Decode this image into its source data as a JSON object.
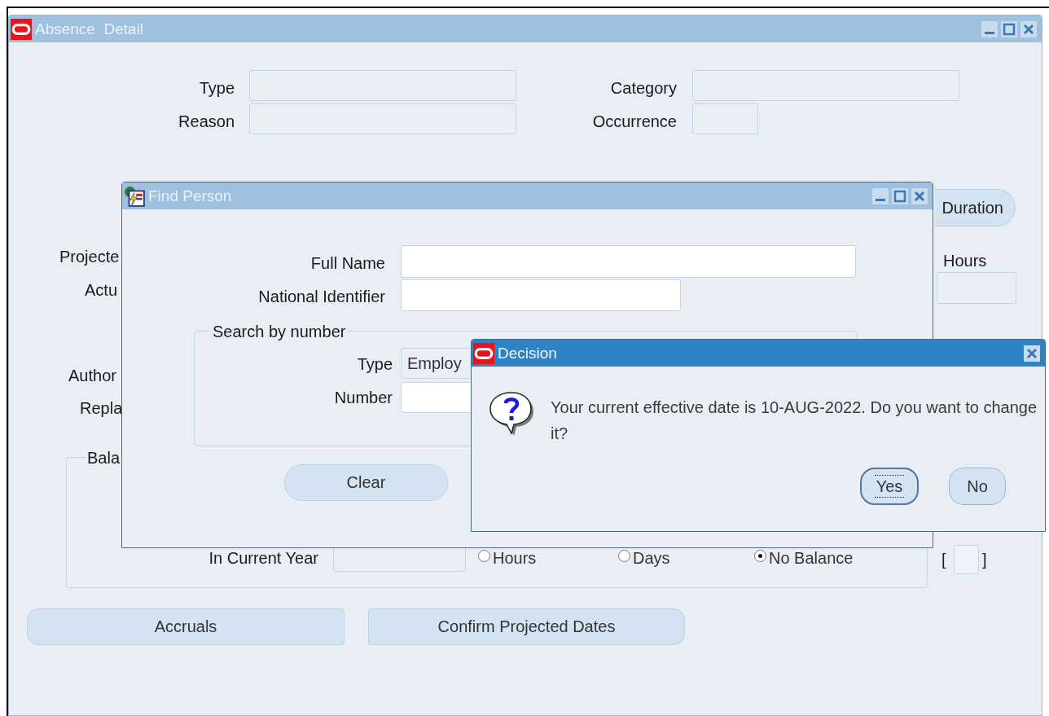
{
  "main_window": {
    "title": "Absence  Detail",
    "fields": [
      {
        "label": "Type"
      },
      {
        "label": "Category"
      },
      {
        "label": "Reason"
      },
      {
        "label": "Occurrence"
      }
    ],
    "duration_button": "Duration",
    "hours_label": "Hours",
    "partial_labels": [
      "Projecte",
      "Actu",
      "Author",
      "Repla"
    ],
    "balance": {
      "legend": "Bala",
      "in_current_year": "In Current Year",
      "units": [
        {
          "label": "Hours",
          "selected": false
        },
        {
          "label": "Days",
          "selected": false
        },
        {
          "label": "No Balance",
          "selected": true
        }
      ],
      "bracket_open": "[",
      "bracket_close": "]"
    },
    "buttons": [
      "Accruals",
      "Confirm Projected Dates"
    ]
  },
  "find_person": {
    "title": "Find Person",
    "fields": [
      {
        "label": "Full Name"
      },
      {
        "label": "National Identifier"
      }
    ],
    "search_group": {
      "legend": "Search by number",
      "type_label": "Type",
      "type_value": "Employ",
      "number_label": "Number"
    },
    "buttons": [
      "Clear"
    ]
  },
  "decision": {
    "title": "Decision",
    "message": "Your current effective date is 10-AUG-2022. Do you want to change it?",
    "buttons": [
      {
        "label": "Yes",
        "focused": true
      },
      {
        "label": "No",
        "focused": false
      }
    ]
  }
}
